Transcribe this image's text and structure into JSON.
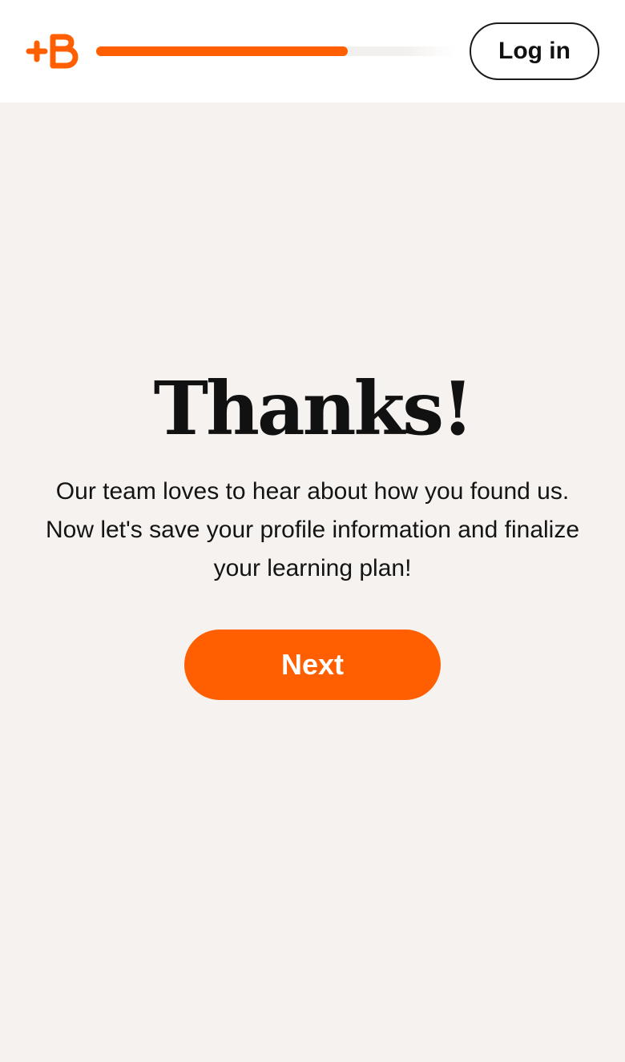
{
  "header": {
    "logo_icon": "babbel-plus-b-logo-icon",
    "progress_fraction": 0.7,
    "login_label": "Log in"
  },
  "main": {
    "title": "Thanks!",
    "description": "Our team loves to hear about how you found us. Now let's save your profile information and finalize your learning plan!",
    "next_label": "Next"
  },
  "colors": {
    "brand_orange": "#ff5f00",
    "background": "#f6f2ef",
    "header_background": "#ffffff",
    "text_dark": "#111111"
  }
}
